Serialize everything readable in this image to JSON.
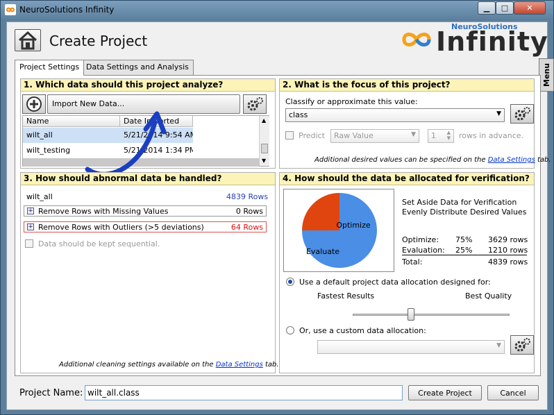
{
  "window": {
    "title": "NeuroSolutions Infinity"
  },
  "header": {
    "title": "Create Project",
    "logo_brand": "NeuroSolutions",
    "logo_word": "Infinity",
    "menu_label": "Menu"
  },
  "tabs": [
    {
      "label": "Project Settings",
      "active": true
    },
    {
      "label": "Data Settings and Analysis",
      "active": false
    }
  ],
  "section1": {
    "heading": "1. Which data should this project analyze?",
    "import_label": "Import New Data...",
    "columns": [
      "Name",
      "Date Imported"
    ],
    "rows": [
      {
        "name": "wilt_all",
        "date": "5/21/2014 9:54 AM"
      },
      {
        "name": "wilt_testing",
        "date": "5/21/2014 1:34 PM"
      }
    ]
  },
  "section2": {
    "heading": "2. What is the focus of this project?",
    "classify_label": "Classify or approximate this value:",
    "target_value": "class",
    "predict_label": "Predict",
    "predict_value": "Raw Value",
    "rows_value": "1",
    "rows_label": "rows in advance.",
    "note_prefix": "Additional desired values can be specified on the",
    "note_link": "Data Settings",
    "note_suffix": "tab."
  },
  "section3": {
    "heading": "3. How should abnormal data be handled?",
    "dataset": "wilt_all",
    "dataset_rows": "4839 Rows",
    "missing_label": "Remove Rows with Missing Values",
    "missing_rows": "0 Rows",
    "outliers_label": "Remove Rows with Outliers (>5 deviations)",
    "outliers_rows": "64 Rows",
    "sequential_label": "Data should be kept sequential.",
    "note_prefix": "Additional cleaning settings available on the",
    "note_link": "Data Settings",
    "note_suffix": "tab."
  },
  "section4": {
    "heading": "4. How should the data be allocated for verification?",
    "setaside_1": "Set Aside Data for Verification",
    "setaside_2": "Evenly Distribute Desired Values",
    "optimize_label": "Optimize:",
    "optimize_pct": "75%",
    "optimize_rows": "3629 rows",
    "evaluation_label": "Evaluation:",
    "evaluation_pct": "25%",
    "evaluation_rows": "1210 rows",
    "total_label": "Total:",
    "total_rows": "4839 rows",
    "default_alloc_label": "Use a default project data allocation designed for:",
    "fastest_label": "Fastest Results",
    "best_label": "Best Quality",
    "slider_level": 0.37,
    "custom_alloc_label": "Or, use a custom data allocation:"
  },
  "chart_data": {
    "type": "pie",
    "categories": [
      "Optimize",
      "Evaluate"
    ],
    "values": [
      75,
      25
    ],
    "colors": [
      "#4a8ee6",
      "#e0450f"
    ]
  },
  "footer": {
    "project_name_label": "Project Name:",
    "project_name_value": "wilt_all.class",
    "create_label": "Create Project",
    "cancel_label": "Cancel"
  }
}
